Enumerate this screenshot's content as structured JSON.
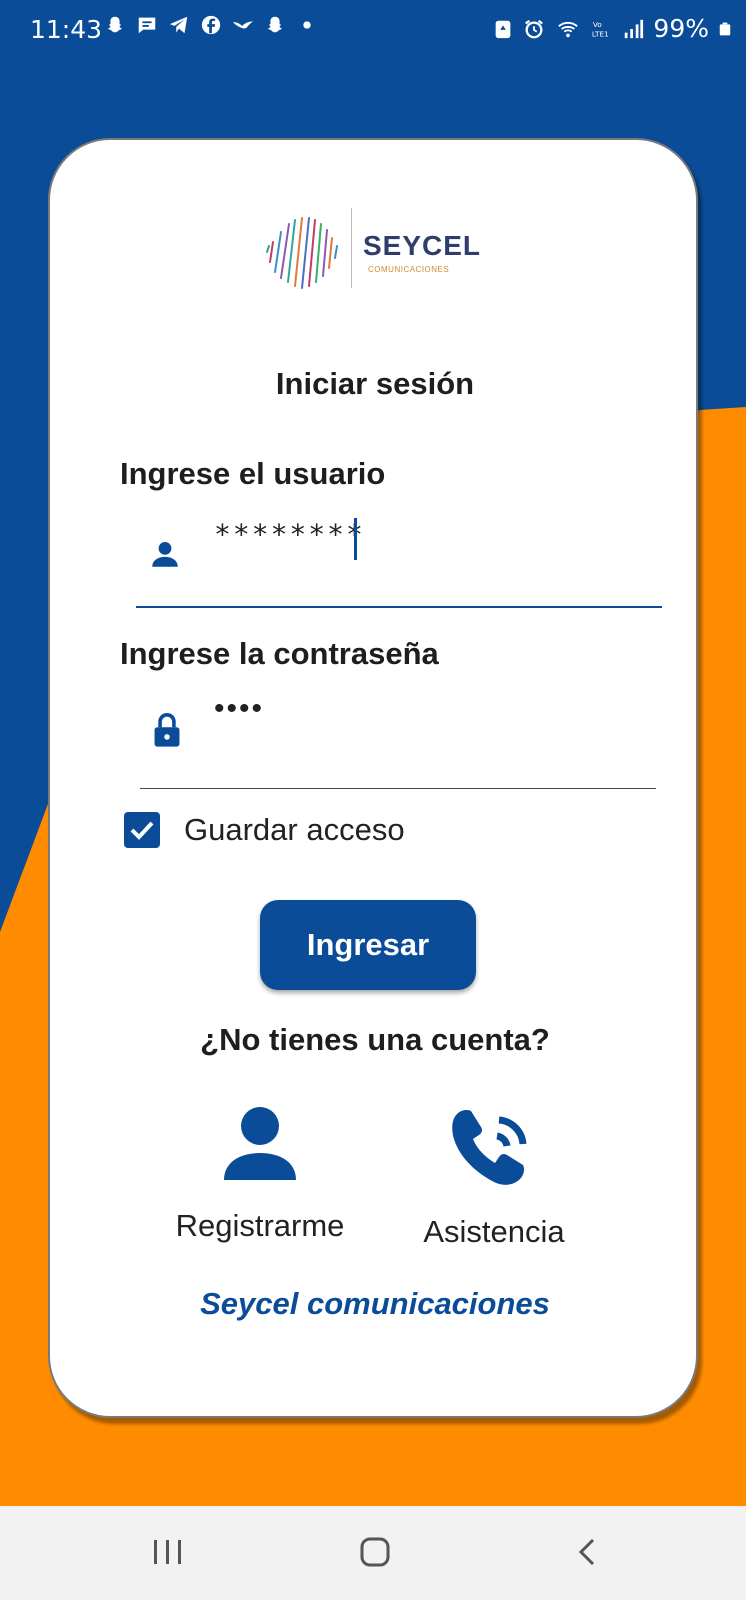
{
  "status_bar": {
    "time": "11:43",
    "battery": "99%",
    "left_icons": [
      "snapchat-icon",
      "message-icon",
      "telegram-icon",
      "facebook-icon",
      "bird-icon",
      "snapchat-icon",
      "dot-icon"
    ],
    "right_icons": [
      "recycle-icon",
      "alarm-icon",
      "wifi-icon",
      "lte-icon",
      "signal-icon",
      "battery-icon"
    ]
  },
  "logo": {
    "name": "SEYCEL",
    "subtitle": "COMUNICACIONES"
  },
  "login": {
    "title": "Iniciar sesión",
    "user_label": "Ingrese el usuario",
    "user_value": "********",
    "password_label": "Ingrese la contraseña",
    "password_value": "••••",
    "remember_label": "Guardar acceso",
    "remember_checked": true,
    "submit_label": "Ingresar"
  },
  "signup": {
    "question": "¿No tienes una cuenta?",
    "register_label": "Registrarme",
    "help_label": "Asistencia"
  },
  "footer": {
    "brand": "Seycel comunicaciones"
  },
  "colors": {
    "primary": "#0A4C97",
    "accent": "#FF8C00",
    "card": "#FFFFFF",
    "nav": "#F2F2F2"
  }
}
